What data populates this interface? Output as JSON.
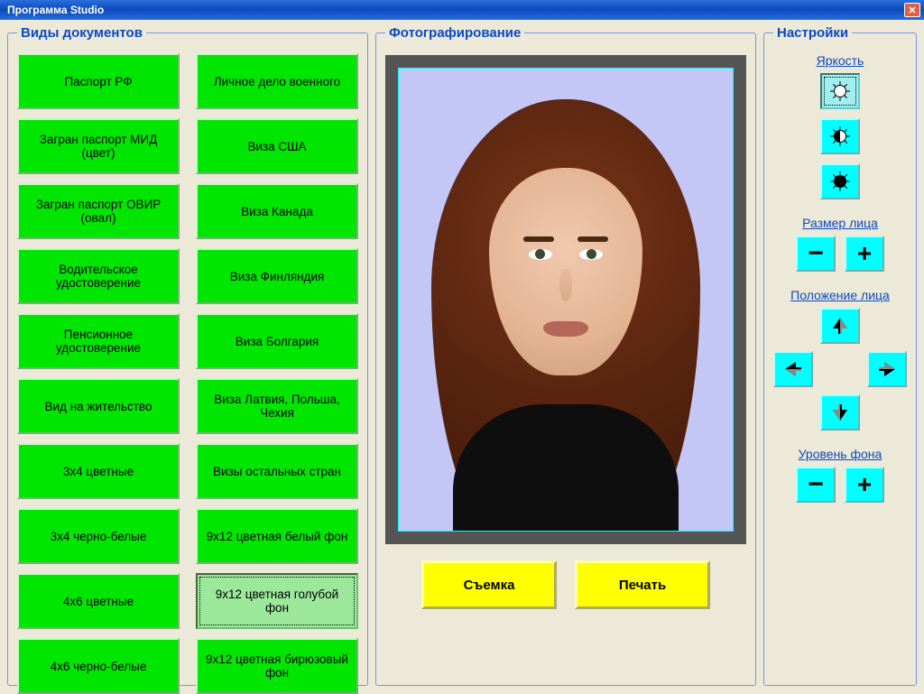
{
  "window": {
    "title": "Программа Studio"
  },
  "docs": {
    "legend": "Виды документов",
    "selected": 17,
    "items": [
      "Паспорт РФ",
      "Личное дело военного",
      "Загран паспорт МИД (цвет)",
      "Виза США",
      "Загран паспорт ОВИР (овал)",
      "Виза Канада",
      "Водительское удостоверение",
      "Виза Финляндия",
      "Пенсионное удостоверение",
      "Виза Болгария",
      "Вид на жительство",
      "Виза Латвия, Польша, Чехия",
      "3х4 цветные",
      "Визы остальных стран",
      "3х4 черно-белые",
      "9х12 цветная белый фон",
      "4х6 цветные",
      "9х12 цветная голубой фон",
      "4х6 черно-белые",
      "9х12 цветная бирюзовый фон"
    ]
  },
  "photo": {
    "legend": "Фотографирование",
    "capture": "Съемка",
    "print": "Печать"
  },
  "settings": {
    "legend": "Настройки",
    "brightness_label": "Яркость",
    "brightness_selected": 0,
    "face_size_label": "Размер лица",
    "face_pos_label": "Положение лица",
    "bg_level_label": "Уровень фона",
    "minus": "−",
    "plus": "+"
  }
}
